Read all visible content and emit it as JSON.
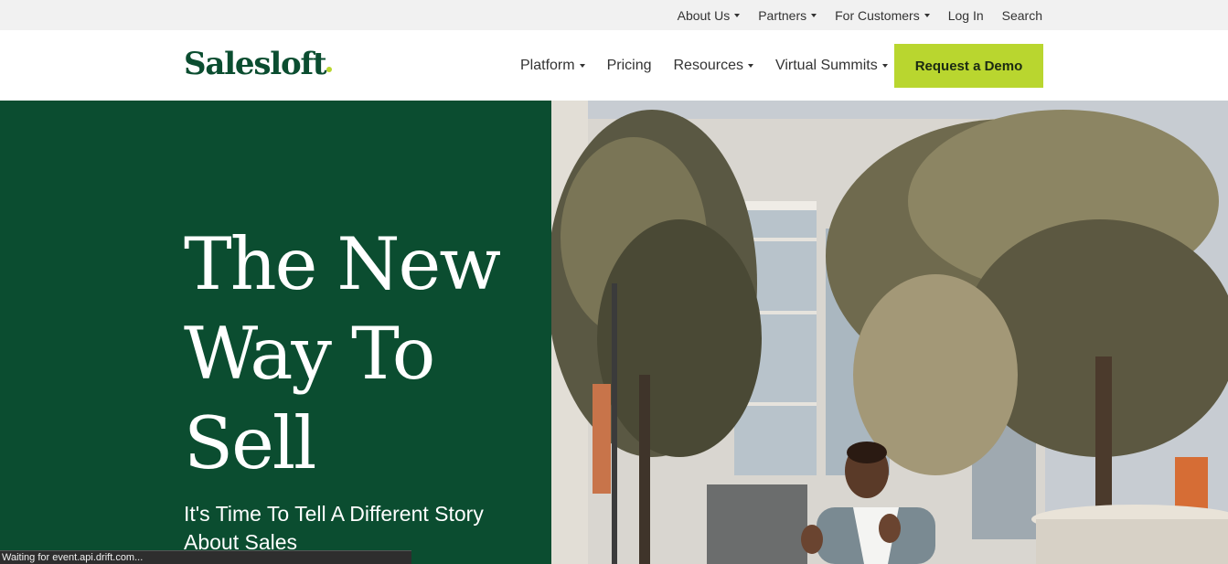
{
  "utility_nav": [
    {
      "label": "About Us",
      "has_dropdown": true
    },
    {
      "label": "Partners",
      "has_dropdown": true
    },
    {
      "label": "For Customers",
      "has_dropdown": true
    },
    {
      "label": "Log In",
      "has_dropdown": false
    },
    {
      "label": "Search",
      "has_dropdown": false
    }
  ],
  "header": {
    "logo_text": "Salesloft",
    "nav": [
      {
        "label": "Platform",
        "has_dropdown": true
      },
      {
        "label": "Pricing",
        "has_dropdown": false
      },
      {
        "label": "Resources",
        "has_dropdown": true
      },
      {
        "label": "Virtual Summits",
        "has_dropdown": true
      }
    ],
    "cta_label": "Request a Demo"
  },
  "hero": {
    "title_lines": [
      "The New",
      "Way To",
      "Sell"
    ],
    "subtitle": "It's Time To Tell A Different Story About Sales"
  },
  "status_bar": {
    "text": "Waiting for event.api.drift.com..."
  },
  "colors": {
    "brand_green": "#0b4d30",
    "accent_lime": "#b9d62f",
    "utility_bg": "#f1f1f1"
  }
}
